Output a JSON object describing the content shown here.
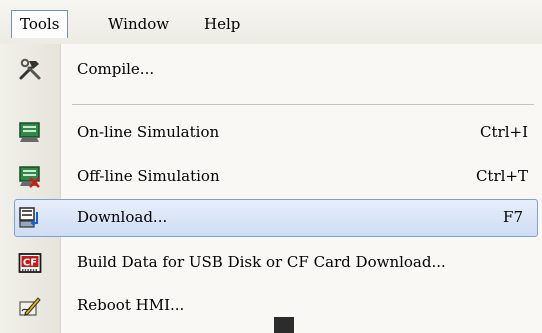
{
  "menubar": {
    "items": [
      {
        "label": "Tools",
        "active": true
      },
      {
        "label": "Window",
        "active": false
      },
      {
        "label": "Help",
        "active": false
      }
    ]
  },
  "tools_menu": {
    "items": [
      {
        "label": "Compile...",
        "shortcut": "",
        "icon": "hammer-wrench-icon"
      },
      {
        "label": "On-line Simulation",
        "shortcut": "Ctrl+I",
        "icon": "online-simulation-icon"
      },
      {
        "label": "Off-line Simulation",
        "shortcut": "Ctrl+T",
        "icon": "offline-simulation-icon"
      },
      {
        "label": "Download...",
        "shortcut": "F7",
        "icon": "download-icon",
        "highlighted": true
      },
      {
        "label": "Build Data for USB Disk or CF Card Download...",
        "shortcut": "",
        "icon": "cf-card-icon",
        "icon_text": "CF"
      },
      {
        "label": "Reboot HMI...",
        "shortcut": "",
        "icon": "reboot-pen-icon"
      }
    ]
  },
  "colors": {
    "highlight_border": "#7ea0d8",
    "highlight_fill": "#d8e3f6",
    "icon_column": "#e9e7de"
  }
}
